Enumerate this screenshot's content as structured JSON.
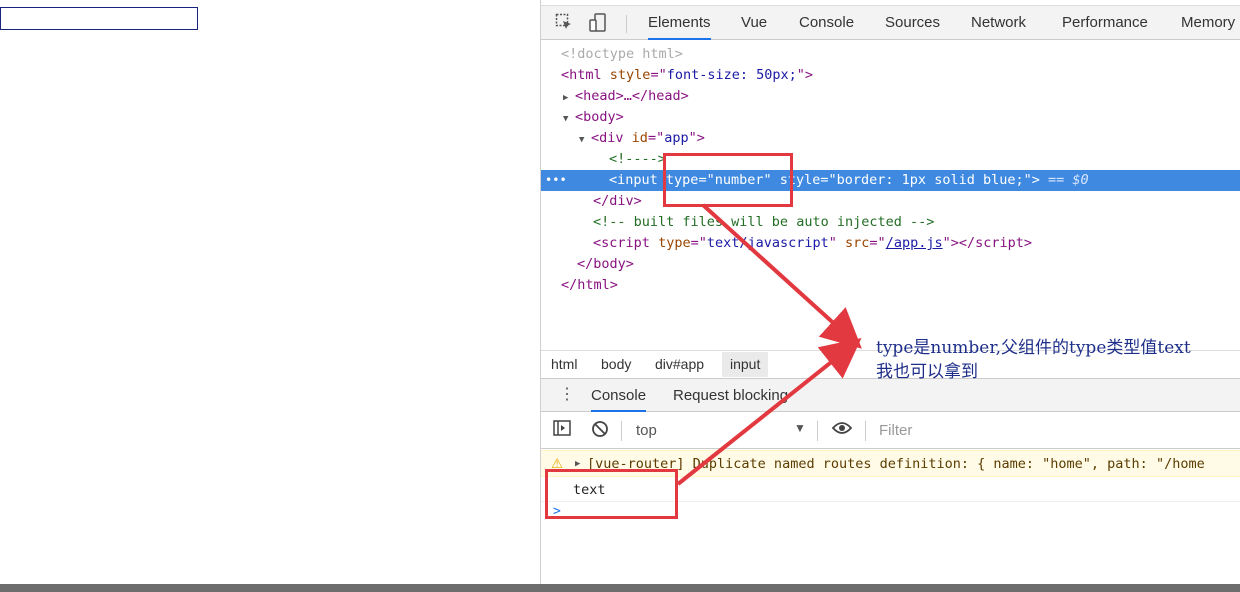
{
  "devtools": {
    "tabs": [
      "Elements",
      "Vue",
      "Console",
      "Sources",
      "Network",
      "Performance",
      "Memory"
    ],
    "active_tab": "Elements"
  },
  "elements_tree": {
    "doctype": "<!doctype html>",
    "html_open": {
      "tag": "html",
      "attr": "style",
      "value": "font-size: 50px;"
    },
    "head": "<head>…</head>",
    "body_open": "<body>",
    "div_app": {
      "tag": "div",
      "attr": "id",
      "value": "app"
    },
    "comment_empty": "<!---->",
    "input_line": {
      "tag": "input",
      "attr1": "type",
      "val1": "number",
      "attr2": "style",
      "val2": "border: 1px solid blue;",
      "eq": "== $0"
    },
    "div_close": "</div>",
    "comment_built": "<!-- built files will be auto injected -->",
    "script": {
      "tag": "script",
      "attr1": "type",
      "val1": "text/javascript",
      "attr2": "src",
      "val2": "/app.js"
    },
    "body_close": "</body>",
    "html_close": "</html>"
  },
  "breadcrumb": [
    "html",
    "body",
    "div#app",
    "input"
  ],
  "drawer": {
    "tabs": [
      "Console",
      "Request blocking"
    ],
    "context": "top",
    "filter_placeholder": "Filter"
  },
  "console": {
    "warning": "[vue-router] Duplicate named routes definition: { name: \"home\", path: \"/home",
    "log": "text",
    "prompt": ">"
  },
  "annotation": {
    "line1": "type是number,父组件的type类型值text",
    "line2": "我也可以拿到",
    "color": "#e2383f"
  }
}
